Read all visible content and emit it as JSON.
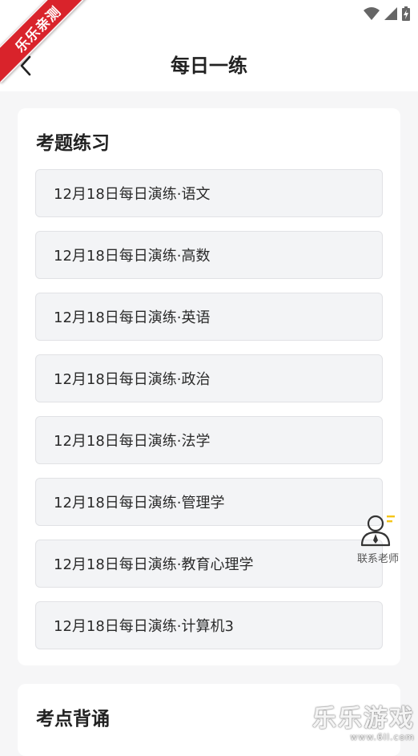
{
  "app": {
    "ribbon_text": "乐乐亲测",
    "title": "每日一练"
  },
  "practice": {
    "heading": "考题练习",
    "items": [
      "12月18日每日演练·语文",
      "12月18日每日演练·高数",
      "12月18日每日演练·英语",
      "12月18日每日演练·政治",
      "12月18日每日演练·法学",
      "12月18日每日演练·管理学",
      "12月18日每日演练·教育心理学",
      "12月18日每日演练·计算机3"
    ]
  },
  "recite": {
    "heading": "考点背诵"
  },
  "contact": {
    "label": "联系老师",
    "icon": "teacher-icon"
  },
  "watermark": {
    "text": "乐乐游戏",
    "url": "www.6ll.com"
  },
  "colors": {
    "ribbon": "#d9232b",
    "accent": "#f5c518",
    "background": "#f6f6f7"
  }
}
